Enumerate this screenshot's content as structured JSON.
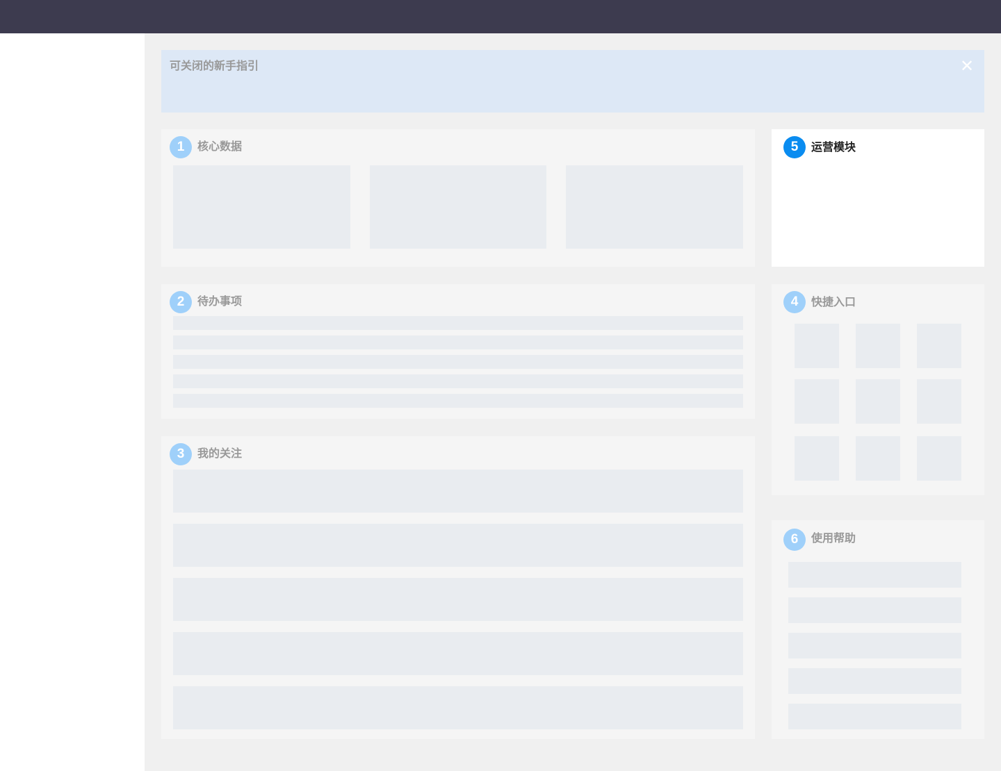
{
  "guide": {
    "title": "可关闭的新手指引",
    "close_icon": "close-icon"
  },
  "sections": {
    "core_data": {
      "number": "1",
      "title": "核心数据"
    },
    "todo": {
      "number": "2",
      "title": "待办事项"
    },
    "follow": {
      "number": "3",
      "title": "我的关注"
    },
    "shortcuts": {
      "number": "4",
      "title": "快捷入口"
    },
    "operations": {
      "number": "5",
      "title": "运营模块"
    },
    "help": {
      "number": "6",
      "title": "使用帮助"
    }
  },
  "colors": {
    "topbar": "#3d3b4f",
    "content_bg": "#f0f0f0",
    "guide_bg": "#dde8f6",
    "card_bg": "#f5f5f5",
    "placeholder": "#e9ecf0",
    "badge_inactive": "#9fd0fa",
    "badge_active": "#0a8cf0"
  }
}
